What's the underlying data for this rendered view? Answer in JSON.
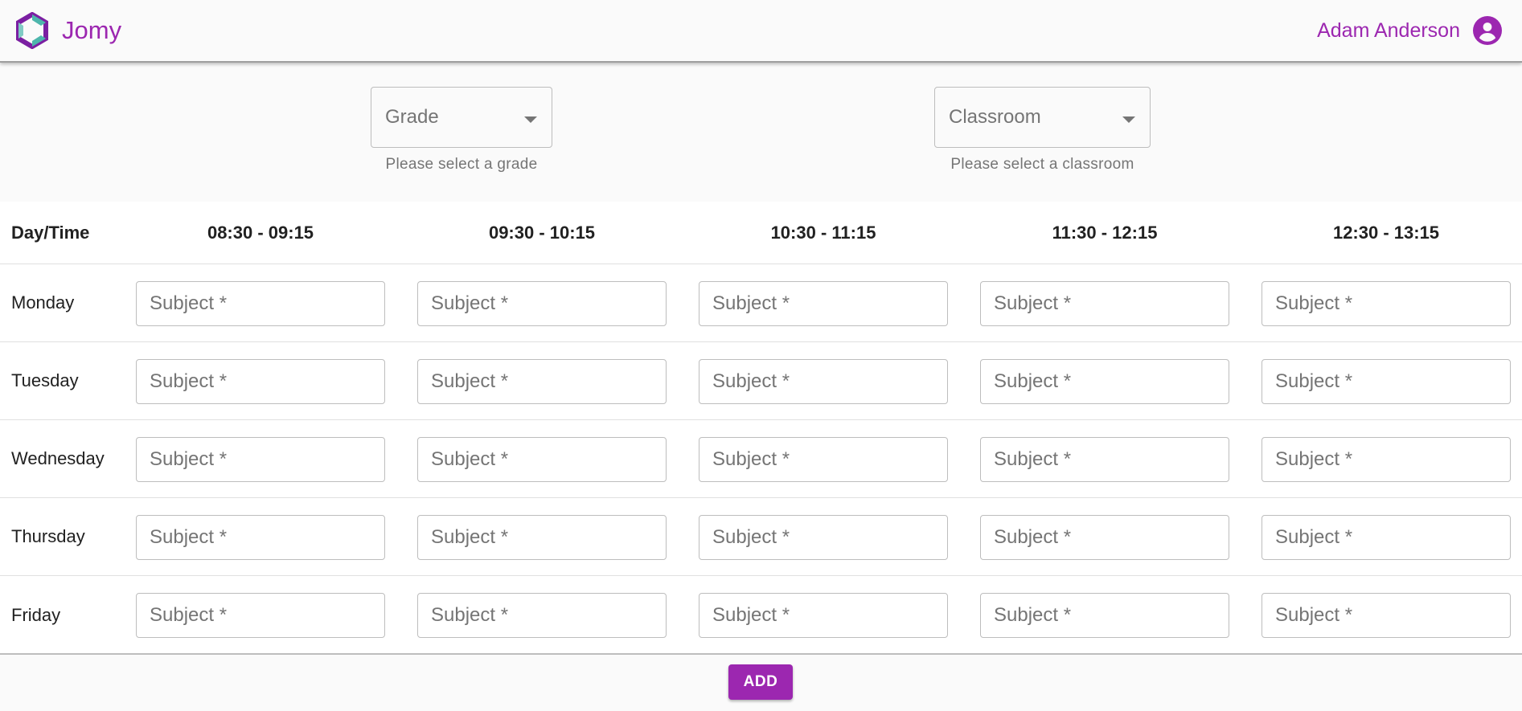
{
  "app": {
    "name": "Jomy",
    "accent": "#9c27b0"
  },
  "user": {
    "name": "Adam Anderson",
    "icon": "account-circle-icon"
  },
  "filters": {
    "grade": {
      "label": "Grade",
      "helper": "Please select a grade"
    },
    "classroom": {
      "label": "Classroom",
      "helper": "Please select a classroom"
    }
  },
  "schedule": {
    "corner_label": "Day/Time",
    "times": [
      "08:30 - 09:15",
      "09:30 - 10:15",
      "10:30 - 11:15",
      "11:30 - 12:15",
      "12:30 - 13:15"
    ],
    "days": [
      "Monday",
      "Tuesday",
      "Wednesday",
      "Thursday",
      "Friday"
    ],
    "subject_placeholder": "Subject *"
  },
  "actions": {
    "add_label": "ADD"
  }
}
